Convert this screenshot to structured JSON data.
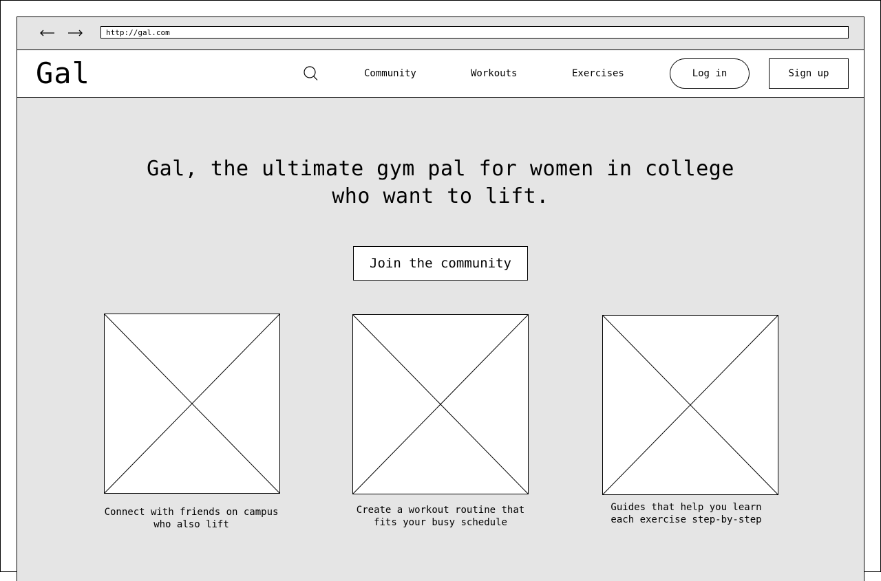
{
  "browser": {
    "url": "http://gal.com",
    "back_icon": "arrow-left-icon",
    "forward_icon": "arrow-right-icon"
  },
  "header": {
    "logo": "Gal",
    "search_icon": "search-icon",
    "nav": {
      "community": "Community",
      "workouts": "Workouts",
      "exercises": "Exercises"
    },
    "login_label": "Log in",
    "signup_label": "Sign up"
  },
  "hero": {
    "title": "Gal, the ultimate gym pal for women in college\nwho want to lift.",
    "cta_label": "Join the community"
  },
  "features": [
    {
      "caption": "Connect with friends on campus\nwho also lift"
    },
    {
      "caption": "Create a  workout routine that\nfits your busy schedule"
    },
    {
      "caption": "Guides that help you learn\neach exercise step-by-step"
    }
  ]
}
